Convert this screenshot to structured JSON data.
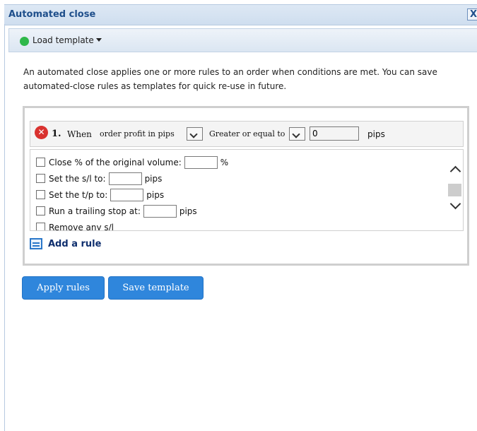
{
  "dialog": {
    "title": "Automated close",
    "close_symbol": "X",
    "toolbar": {
      "load_template_label": "Load template",
      "status_color": "#2fb84a"
    },
    "description": "An automated close applies one or more rules to an order when conditions are met. You can save automated-close rules as templates for quick re-use in future."
  },
  "rule": {
    "number": "1.",
    "when_label": "When",
    "condition_select": "order profit in pips",
    "operator_select": "Greater or equal to",
    "value": "0",
    "unit": "pips",
    "actions": [
      {
        "label": "Close % of the original volume:",
        "suffix": "%"
      },
      {
        "label": "Set the s/l to:",
        "suffix": "pips"
      },
      {
        "label": "Set the t/p to:",
        "suffix": "pips"
      },
      {
        "label": "Run a trailing stop at:",
        "suffix": "pips"
      },
      {
        "label": "Remove any s/l",
        "suffix": ""
      }
    ]
  },
  "add_rule_label": "Add a rule",
  "buttons": {
    "apply": "Apply rules",
    "save": "Save template"
  },
  "colors": {
    "accent": "#2f86dc",
    "title": "#1f4f8b",
    "remove": "#d9322f"
  }
}
